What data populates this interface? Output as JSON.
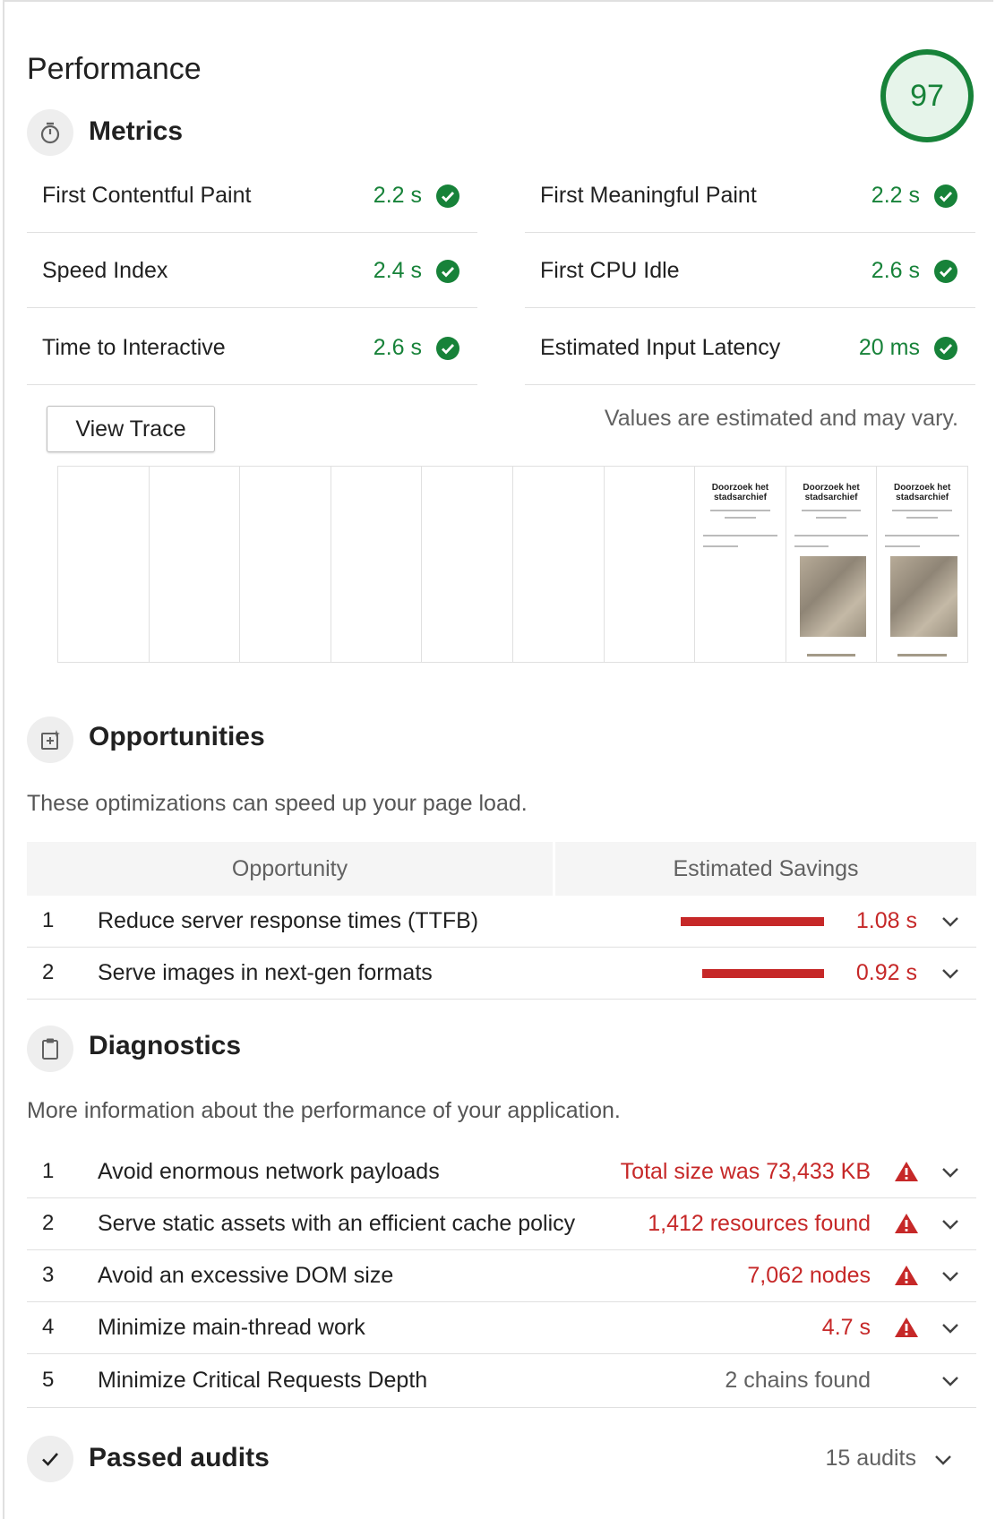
{
  "header": {
    "title": "Performance",
    "score": "97"
  },
  "metrics_section": {
    "title": "Metrics",
    "items": [
      {
        "label": "First Contentful Paint",
        "value": "2.2 s"
      },
      {
        "label": "First Meaningful Paint",
        "value": "2.2 s"
      },
      {
        "label": "Speed Index",
        "value": "2.4 s"
      },
      {
        "label": "First CPU Idle",
        "value": "2.6 s"
      },
      {
        "label": "Time to Interactive",
        "value": "2.6 s"
      },
      {
        "label": "Estimated Input Latency",
        "value": "20 ms"
      }
    ],
    "view_trace_label": "View Trace",
    "disclaimer": "Values are estimated and may vary."
  },
  "filmstrip": {
    "thumbnail_heading": "Doorzoek het stadsarchief"
  },
  "opportunities": {
    "title": "Opportunities",
    "description": "These optimizations can speed up your page load.",
    "col_opportunity": "Opportunity",
    "col_savings": "Estimated Savings",
    "items": [
      {
        "num": "1",
        "label": "Reduce server response times (TTFB)",
        "savings": "1.08 s",
        "savings_seconds": 1.08
      },
      {
        "num": "2",
        "label": "Serve images in next-gen formats",
        "savings": "0.92 s",
        "savings_seconds": 0.92
      }
    ]
  },
  "diagnostics": {
    "title": "Diagnostics",
    "description": "More information about the performance of your application.",
    "items": [
      {
        "num": "1",
        "label": "Avoid enormous network payloads",
        "value": "Total size was 73,433 KB",
        "warning": true
      },
      {
        "num": "2",
        "label": "Serve static assets with an efficient cache policy",
        "value": "1,412 resources found",
        "warning": true
      },
      {
        "num": "3",
        "label": "Avoid an excessive DOM size",
        "value": "7,062 nodes",
        "warning": true
      },
      {
        "num": "4",
        "label": "Minimize main-thread work",
        "value": "4.7 s",
        "warning": true
      },
      {
        "num": "5",
        "label": "Minimize Critical Requests Depth",
        "value": "2 chains found",
        "warning": false
      }
    ]
  },
  "passed": {
    "title": "Passed audits",
    "count": "15 audits"
  },
  "colors": {
    "pass": "#178239",
    "fail": "#c62828"
  }
}
